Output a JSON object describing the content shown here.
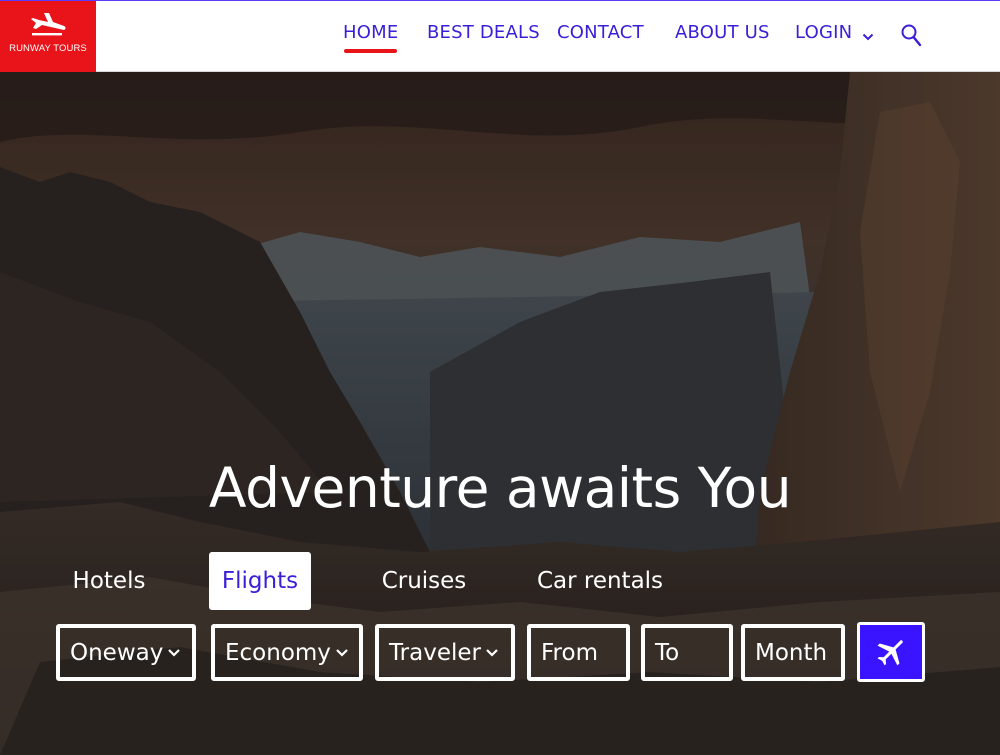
{
  "brand": {
    "name": "RUNWAY TOURS",
    "color": "#e8141a"
  },
  "nav": {
    "items": [
      {
        "label": "HOME",
        "active": true
      },
      {
        "label": "BEST DEALS",
        "active": false
      },
      {
        "label": "CONTACT",
        "active": false
      },
      {
        "label": "ABOUT US",
        "active": false
      },
      {
        "label": "LOGIN",
        "active": false
      }
    ],
    "login_dropdown_icon": "chevron-down-icon",
    "search_icon": "search-icon",
    "accent_color": "#3a1fd8"
  },
  "hero": {
    "headline": "Adventure awaits You",
    "tabs": [
      {
        "label": "Hotels",
        "active": false
      },
      {
        "label": "Flights",
        "active": true
      },
      {
        "label": "Cruises",
        "active": false
      },
      {
        "label": "Car rentals",
        "active": false
      }
    ],
    "search_form": {
      "trip_type": "Oneway",
      "cabin_class": "Economy",
      "travelers": "Traveler",
      "from": "From",
      "to": "To",
      "month": "Month",
      "submit_icon": "airplane-icon",
      "submit_color": "#3b14ff"
    }
  }
}
